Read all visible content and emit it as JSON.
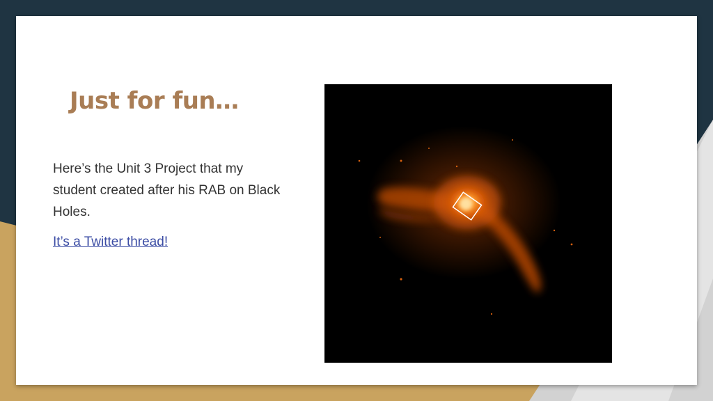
{
  "slide": {
    "title": "Just for fun…",
    "body": "Here’s the Unit 3 Project that my student created after his RAB on Black Holes.",
    "link_text": "It’s a Twitter thread!"
  },
  "image": {
    "subject": "black-hole-galaxy-photo"
  },
  "colors": {
    "title": "#a97d55",
    "text": "#333333",
    "link": "#3b4ca4",
    "background_dark": "#1f3442",
    "background_gold": "#c9a35f",
    "background_gray": "#cfcfcf"
  }
}
